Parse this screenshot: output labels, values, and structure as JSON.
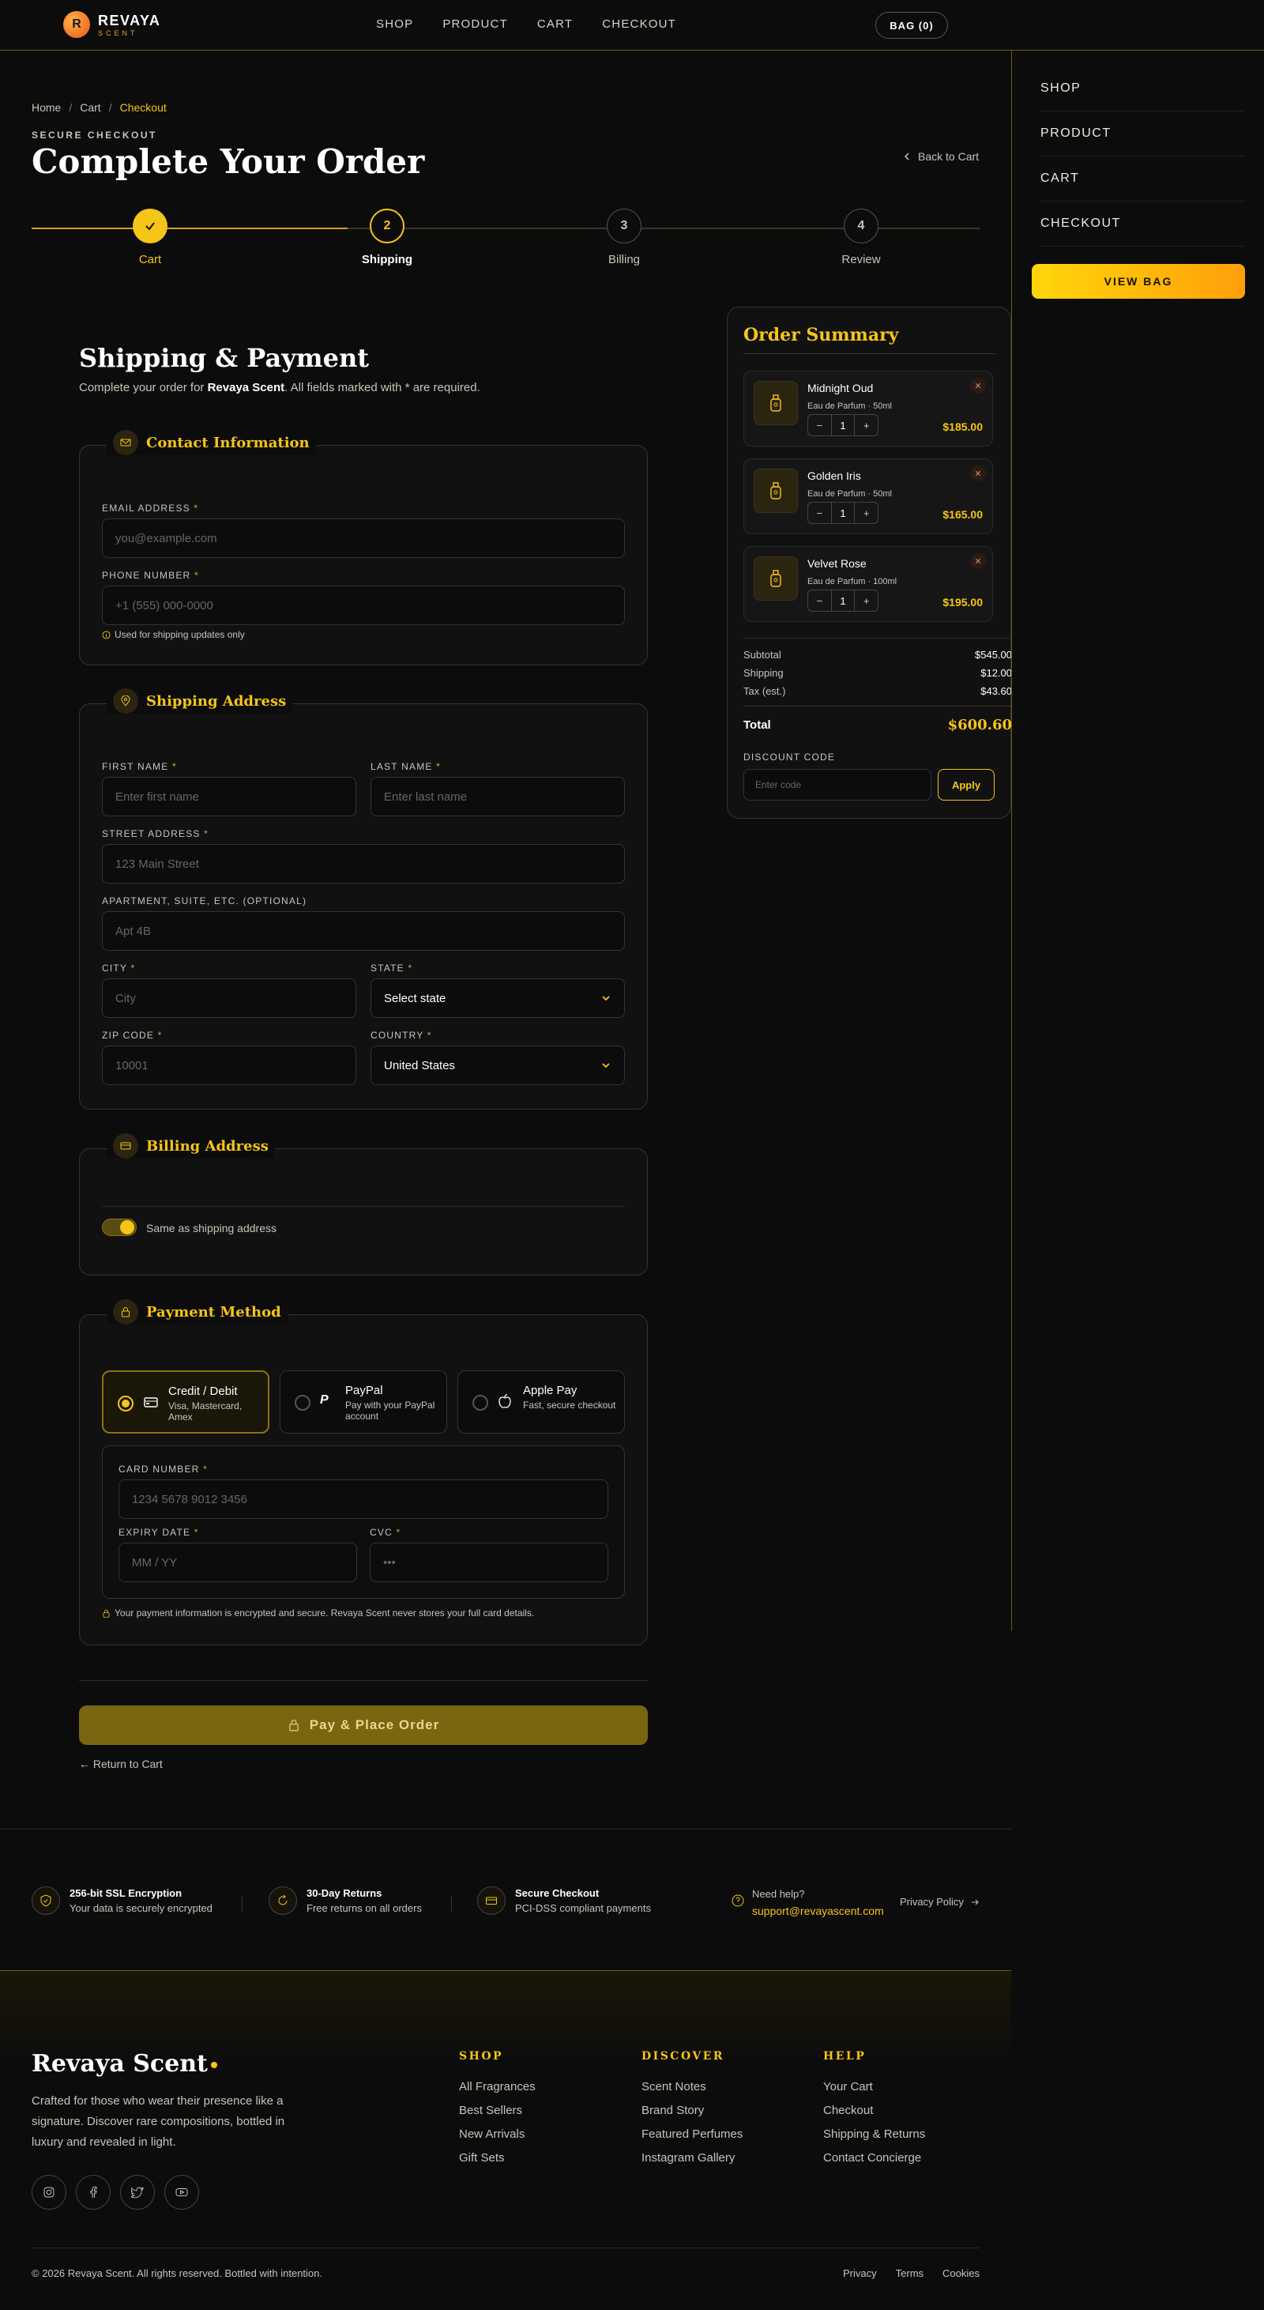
{
  "header": {
    "brand_initial": "R",
    "brand_name": "REVAYA",
    "brand_sub": "SCENT",
    "nav": [
      "SHOP",
      "PRODUCT",
      "CART",
      "CHECKOUT"
    ],
    "bag": "BAG (0)"
  },
  "drawer": {
    "items": [
      "SHOP",
      "PRODUCT",
      "CART",
      "CHECKOUT"
    ],
    "view_bag": "VIEW BAG"
  },
  "breadcrumb": [
    "Home",
    "Cart",
    "Checkout"
  ],
  "page": {
    "eyebrow": "SECURE CHECKOUT",
    "title": "Complete Your Order",
    "back": "Back to Cart"
  },
  "steps": [
    {
      "num": "",
      "label": "Cart"
    },
    {
      "num": "2",
      "label": "Shipping"
    },
    {
      "num": "3",
      "label": "Billing"
    },
    {
      "num": "4",
      "label": "Review"
    }
  ],
  "form": {
    "title": "Shipping & Payment",
    "sub_prefix": "Complete your order for ",
    "sub_brand": "Revaya Scent",
    "sub_suffix": ". All fields marked with * are required.",
    "contact": {
      "title": "Contact Information",
      "email_label": "EMAIL ADDRESS",
      "email_ph": "you@example.com",
      "phone_label": "PHONE NUMBER",
      "phone_ph": "+1 (555) 000-0000",
      "phone_hint": "Used for shipping updates only"
    },
    "shipping": {
      "title": "Shipping Address",
      "first_label": "FIRST NAME",
      "first_ph": "Enter first name",
      "last_label": "LAST NAME",
      "last_ph": "Enter last name",
      "street_label": "STREET ADDRESS",
      "street_ph": "123 Main Street",
      "apt_label": "APARTMENT, SUITE, ETC. (OPTIONAL)",
      "apt_ph": "Apt 4B",
      "city_label": "CITY",
      "city_ph": "City",
      "state_label": "STATE",
      "state_val": "Select state",
      "zip_label": "ZIP CODE",
      "zip_ph": "10001",
      "country_label": "COUNTRY",
      "country_val": "United States"
    },
    "billing": {
      "title": "Billing Address",
      "same": "Same as shipping address"
    },
    "payment": {
      "title": "Payment Method",
      "options": [
        {
          "title": "Credit / Debit",
          "desc": "Visa, Mastercard, Amex"
        },
        {
          "title": "PayPal",
          "desc": "Pay with your PayPal account"
        },
        {
          "title": "Apple Pay",
          "desc": "Fast, secure checkout"
        }
      ],
      "card_label": "CARD NUMBER",
      "card_ph": "1234 5678 9012 3456",
      "exp_label": "EXPIRY DATE",
      "exp_ph": "MM / YY",
      "cvc_label": "CVC",
      "cvc_ph": "•••",
      "secure_note": "Your payment information is encrypted and secure. Revaya Scent never stores your full card details."
    },
    "place_order": "Pay & Place Order",
    "return": "← Return to Cart"
  },
  "summary": {
    "title": "Order Summary",
    "items": [
      {
        "name": "Midnight Oud",
        "desc": "Eau de Parfum · 50ml",
        "qty": "1",
        "price": "$185.00"
      },
      {
        "name": "Golden Iris",
        "desc": "Eau de Parfum · 50ml",
        "qty": "1",
        "price": "$165.00"
      },
      {
        "name": "Velvet Rose",
        "desc": "Eau de Parfum · 100ml",
        "qty": "1",
        "price": "$195.00"
      }
    ],
    "subtotal_label": "Subtotal",
    "subtotal": "$545.00",
    "shipping_label": "Shipping",
    "shipping": "$12.00",
    "tax_label": "Tax (est.)",
    "tax": "$43.60",
    "total_label": "Total",
    "total": "$600.60",
    "discount_label": "DISCOUNT CODE",
    "discount_ph": "Enter code",
    "apply": "Apply"
  },
  "trust": [
    {
      "title": "256-bit SSL Encryption",
      "desc": "Your data is securely encrypted"
    },
    {
      "title": "30-Day Returns",
      "desc": "Free returns on all orders"
    },
    {
      "title": "Secure Checkout",
      "desc": "PCI-DSS compliant payments"
    }
  ],
  "help": {
    "label": "Need help?",
    "email": "support@revayascent.com",
    "privacy": "Privacy Policy"
  },
  "footer": {
    "brand": "Revaya Scent",
    "desc": "Crafted for those who wear their presence like a signature. Discover rare compositions, bottled in luxury and revealed in light.",
    "cols": [
      {
        "title": "SHOP",
        "links": [
          "All Fragrances",
          "Best Sellers",
          "New Arrivals",
          "Gift Sets"
        ]
      },
      {
        "title": "DISCOVER",
        "links": [
          "Scent Notes",
          "Brand Story",
          "Featured Perfumes",
          "Instagram Gallery"
        ]
      },
      {
        "title": "HELP",
        "links": [
          "Your Cart",
          "Checkout",
          "Shipping & Returns",
          "Contact Concierge"
        ]
      }
    ],
    "copyright": "© 2026 Revaya Scent. All rights reserved. Bottled with intention.",
    "legal": [
      "Privacy",
      "Terms",
      "Cookies"
    ]
  }
}
